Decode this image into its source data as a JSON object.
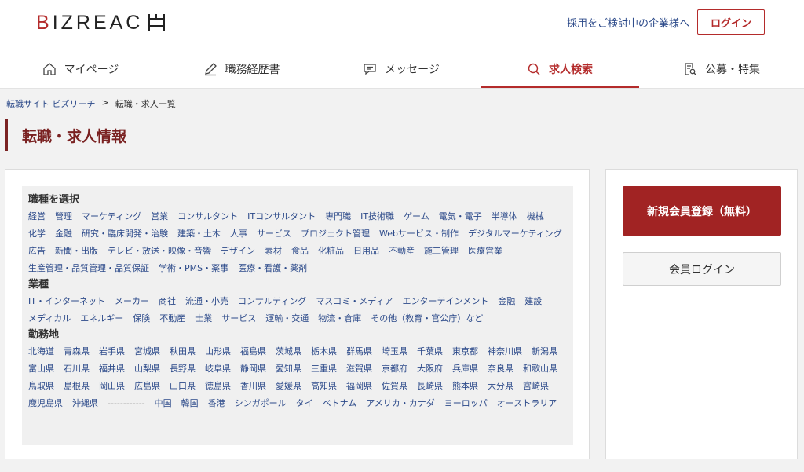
{
  "header": {
    "logo_main": "BIZREAC",
    "employer_link": "採用をご検討中の企業様へ",
    "login_label": "ログイン"
  },
  "nav": [
    {
      "label": "マイページ",
      "icon": "home-icon"
    },
    {
      "label": "職務経歴書",
      "icon": "pencil-icon"
    },
    {
      "label": "メッセージ",
      "icon": "message-icon"
    },
    {
      "label": "求人検索",
      "icon": "search-icon",
      "active": true
    },
    {
      "label": "公募・特集",
      "icon": "document-search-icon"
    }
  ],
  "breadcrumb": {
    "home": "転職サイト ビズリーチ",
    "separator": ">",
    "current": "転職・求人一覧"
  },
  "page_title": "転職・求人情報",
  "sections": [
    {
      "title": "職種を選択",
      "links": [
        "経営",
        "管理",
        "マーケティング",
        "営業",
        "コンサルタント",
        "ITコンサルタント",
        "専門職",
        "IT技術職",
        "ゲーム",
        "電気・電子",
        "半導体",
        "機械",
        "化学",
        "金融",
        "研究・臨床開発・治験",
        "建築・土木",
        "人事",
        "サービス",
        "プロジェクト管理",
        "Webサービス・制作",
        "デジタルマーケティング",
        "広告",
        "新聞・出版",
        "テレビ・放送・映像・音響",
        "デザイン",
        "素材",
        "食品",
        "化粧品",
        "日用品",
        "不動産",
        "施工管理",
        "医療営業",
        "生産管理・品質管理・品質保証",
        "学術・PMS・薬事",
        "医療・看護・薬剤"
      ]
    },
    {
      "title": "業種",
      "links": [
        "IT・インターネット",
        "メーカー",
        "商社",
        "流通・小売",
        "コンサルティング",
        "マスコミ・メディア",
        "エンターテインメント",
        "金融",
        "建設",
        "メディカル",
        "エネルギー",
        "保険",
        "不動産",
        "士業",
        "サービス",
        "運輸・交通",
        "物流・倉庫",
        "その他（教育・官公庁）など"
      ]
    },
    {
      "title": "勤務地",
      "links": [
        "北海道",
        "青森県",
        "岩手県",
        "宮城県",
        "秋田県",
        "山形県",
        "福島県",
        "茨城県",
        "栃木県",
        "群馬県",
        "埼玉県",
        "千葉県",
        "東京都",
        "神奈川県",
        "新潟県",
        "富山県",
        "石川県",
        "福井県",
        "山梨県",
        "長野県",
        "岐阜県",
        "静岡県",
        "愛知県",
        "三重県",
        "滋賀県",
        "京都府",
        "大阪府",
        "兵庫県",
        "奈良県",
        "和歌山県",
        "鳥取県",
        "島根県",
        "岡山県",
        "広島県",
        "山口県",
        "徳島県",
        "香川県",
        "愛媛県",
        "高知県",
        "福岡県",
        "佐賀県",
        "長崎県",
        "熊本県",
        "大分県",
        "宮崎県",
        "鹿児島県",
        "沖縄県",
        "------------",
        "中国",
        "韓国",
        "香港",
        "シンガポール",
        "タイ",
        "ベトナム",
        "アメリカ・カナダ",
        "ヨーロッパ",
        "オーストラリア"
      ]
    }
  ],
  "sidebar": {
    "register_label": "新規会員登録（無料）",
    "member_login_label": "会員ログイン"
  },
  "colors": {
    "brand": "#b42b2b",
    "link": "#2c4a8a",
    "title": "#7a2222"
  }
}
